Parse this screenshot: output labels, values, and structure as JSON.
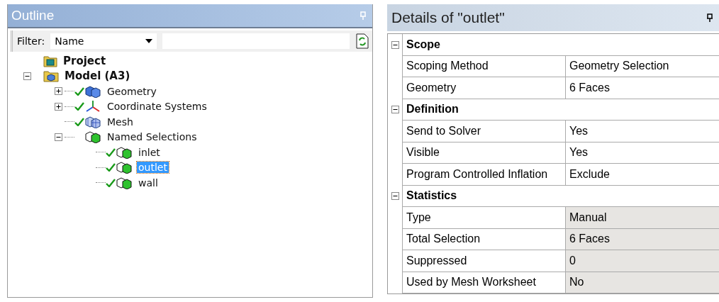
{
  "outline": {
    "title": "Outline",
    "filter": {
      "label": "Filter:",
      "value": "Name"
    },
    "tree": [
      {
        "label": "Project",
        "kind": "project"
      },
      {
        "label": "Model (A3)",
        "kind": "model",
        "expanded": true,
        "children": [
          {
            "label": "Geometry",
            "kind": "geometry",
            "checked": true,
            "expanded": false
          },
          {
            "label": "Coordinate Systems",
            "kind": "coordinates",
            "checked": true,
            "expanded": false
          },
          {
            "label": "Mesh",
            "kind": "mesh",
            "checked": true
          },
          {
            "label": "Named Selections",
            "kind": "named-selections",
            "checked": false,
            "expanded": true,
            "children": [
              {
                "label": "inlet",
                "kind": "selection",
                "checked": true,
                "selected": false
              },
              {
                "label": "outlet",
                "kind": "selection",
                "checked": true,
                "selected": true
              },
              {
                "label": "wall",
                "kind": "selection",
                "checked": true,
                "selected": false
              }
            ]
          }
        ]
      }
    ]
  },
  "details": {
    "title": "Details of \"outlet\"",
    "rows": [
      {
        "kind": "group",
        "label": "Scope",
        "expanded": true
      },
      {
        "kind": "property",
        "label": "Scoping Method",
        "value": "Geometry Selection",
        "readonly": false
      },
      {
        "kind": "property",
        "label": "Geometry",
        "value": "6 Faces",
        "readonly": false
      },
      {
        "kind": "group",
        "label": "Definition",
        "expanded": true
      },
      {
        "kind": "property",
        "label": "Send to Solver",
        "value": "Yes",
        "readonly": false
      },
      {
        "kind": "property",
        "label": "Visible",
        "value": "Yes",
        "readonly": false
      },
      {
        "kind": "property",
        "label": "Program Controlled Inflation",
        "value": "Exclude",
        "readonly": false
      },
      {
        "kind": "group",
        "label": "Statistics",
        "expanded": true
      },
      {
        "kind": "property",
        "label": "Type",
        "value": "Manual",
        "readonly": true
      },
      {
        "kind": "property",
        "label": "Total Selection",
        "value": "6 Faces",
        "readonly": true
      },
      {
        "kind": "property",
        "label": "Suppressed",
        "value": "0",
        "readonly": true
      },
      {
        "kind": "property",
        "label": "Used by Mesh Worksheet",
        "value": "No",
        "readonly": true
      }
    ]
  }
}
